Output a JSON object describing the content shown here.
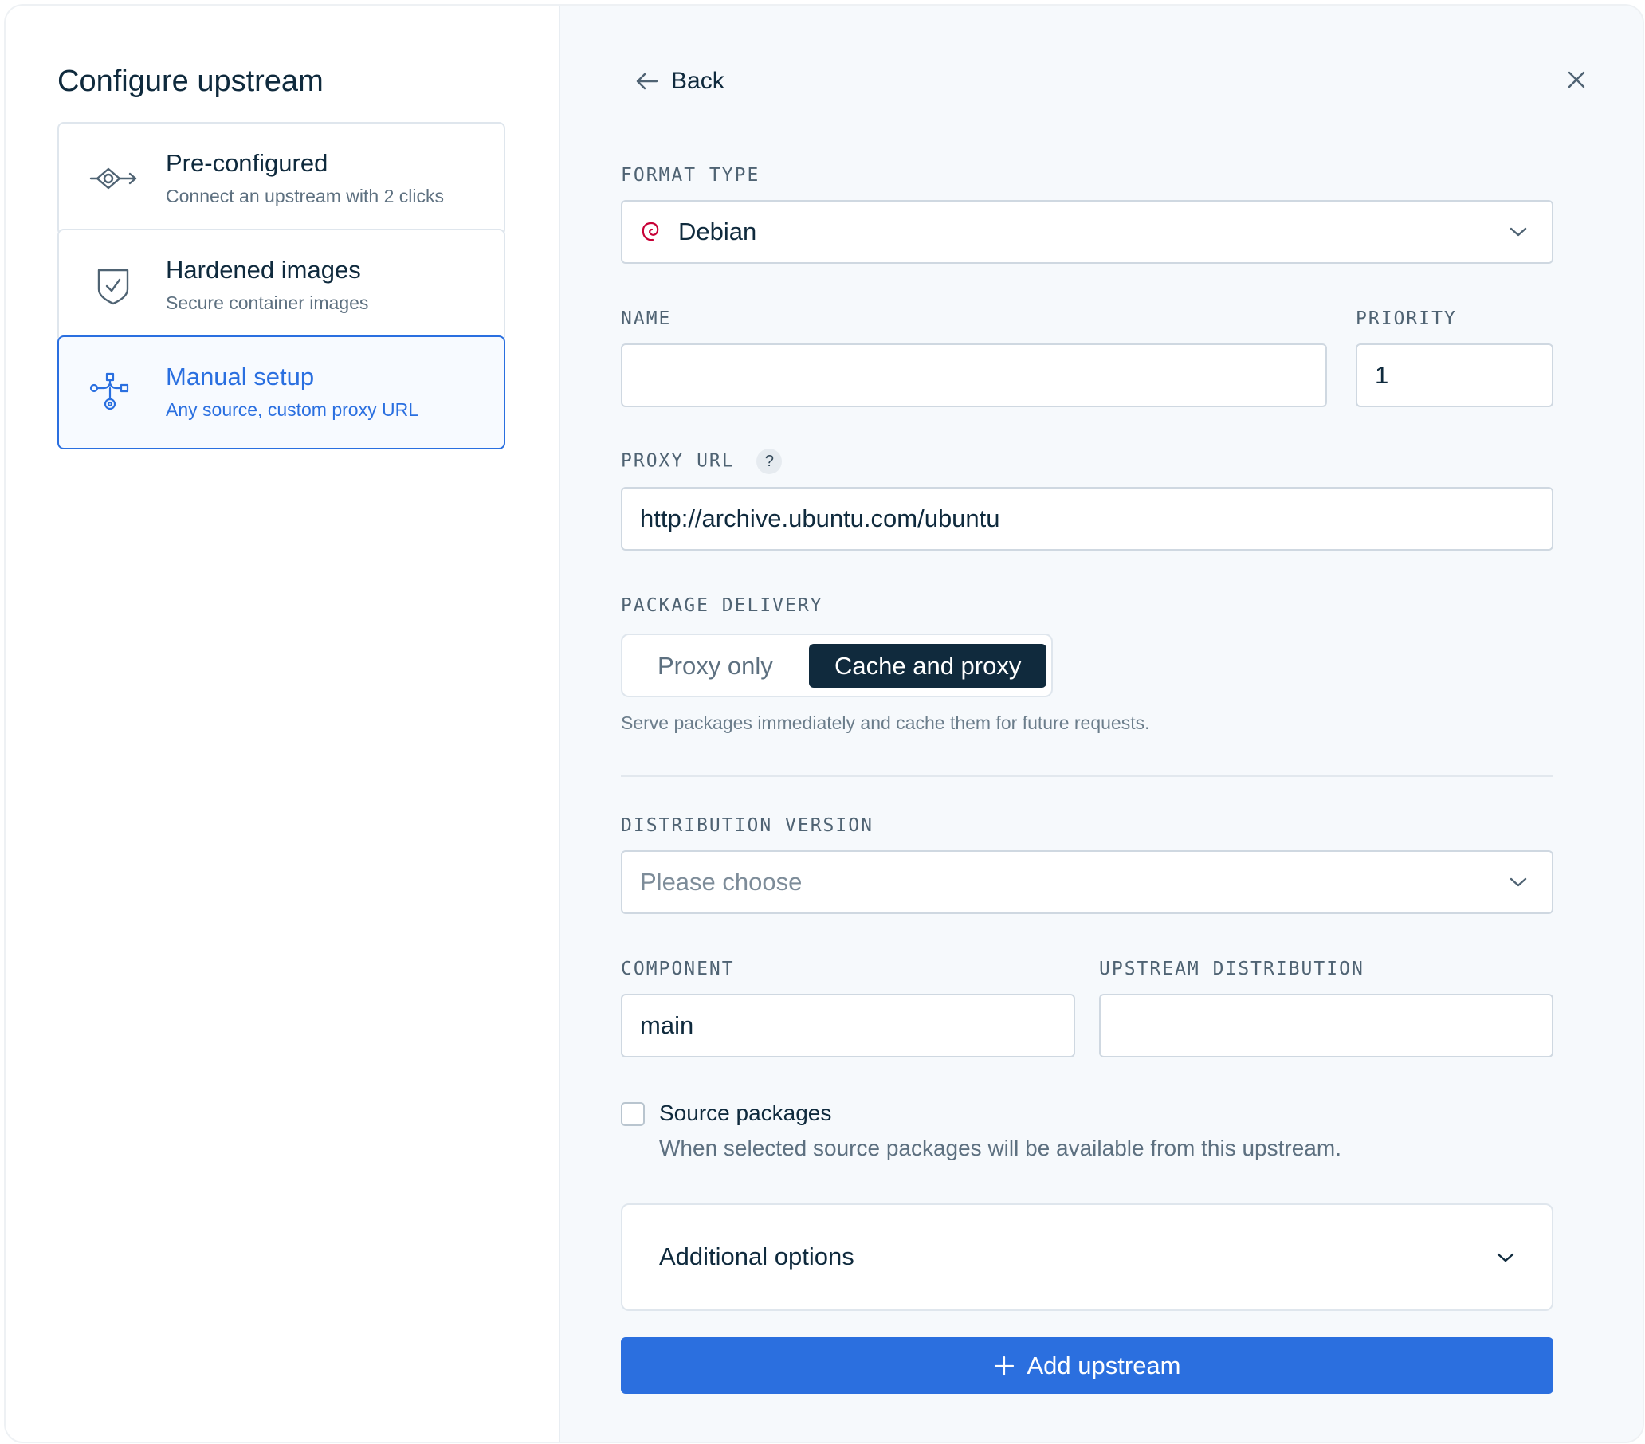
{
  "sidebar": {
    "title": "Configure upstream",
    "options": [
      {
        "title": "Pre-configured",
        "subtitle": "Connect an upstream with 2 clicks",
        "icon": "connector-icon"
      },
      {
        "title": "Hardened images",
        "subtitle": "Secure container images",
        "icon": "shield-check-icon"
      },
      {
        "title": "Manual setup",
        "subtitle": "Any source, custom proxy URL",
        "icon": "network-nodes-icon",
        "active": true
      }
    ]
  },
  "header": {
    "back_label": "Back"
  },
  "form": {
    "format_type": {
      "label": "FORMAT TYPE",
      "value": "Debian",
      "icon": "debian-swirl-icon"
    },
    "name": {
      "label": "NAME",
      "value": ""
    },
    "priority": {
      "label": "PRIORITY",
      "value": "1"
    },
    "proxy_url": {
      "label": "PROXY URL",
      "help": "?",
      "value": "http://archive.ubuntu.com/ubuntu"
    },
    "package_delivery": {
      "label": "PACKAGE DELIVERY",
      "options": [
        "Proxy only",
        "Cache and proxy"
      ],
      "selected": "Cache and proxy",
      "hint": "Serve packages immediately and cache them for future requests."
    },
    "distribution_version": {
      "label": "DISTRIBUTION VERSION",
      "placeholder": "Please choose"
    },
    "component": {
      "label": "COMPONENT",
      "value": "main"
    },
    "upstream_distribution": {
      "label": "UPSTREAM DISTRIBUTION",
      "value": ""
    },
    "source_packages": {
      "label": "Source packages",
      "description": "When selected source packages will be available from this upstream.",
      "checked": false
    },
    "additional_options": {
      "label": "Additional options"
    },
    "submit": {
      "label": "Add upstream"
    }
  },
  "colors": {
    "accent": "#2B6FDF",
    "dark": "#102A3D",
    "debian": "#C70036"
  }
}
